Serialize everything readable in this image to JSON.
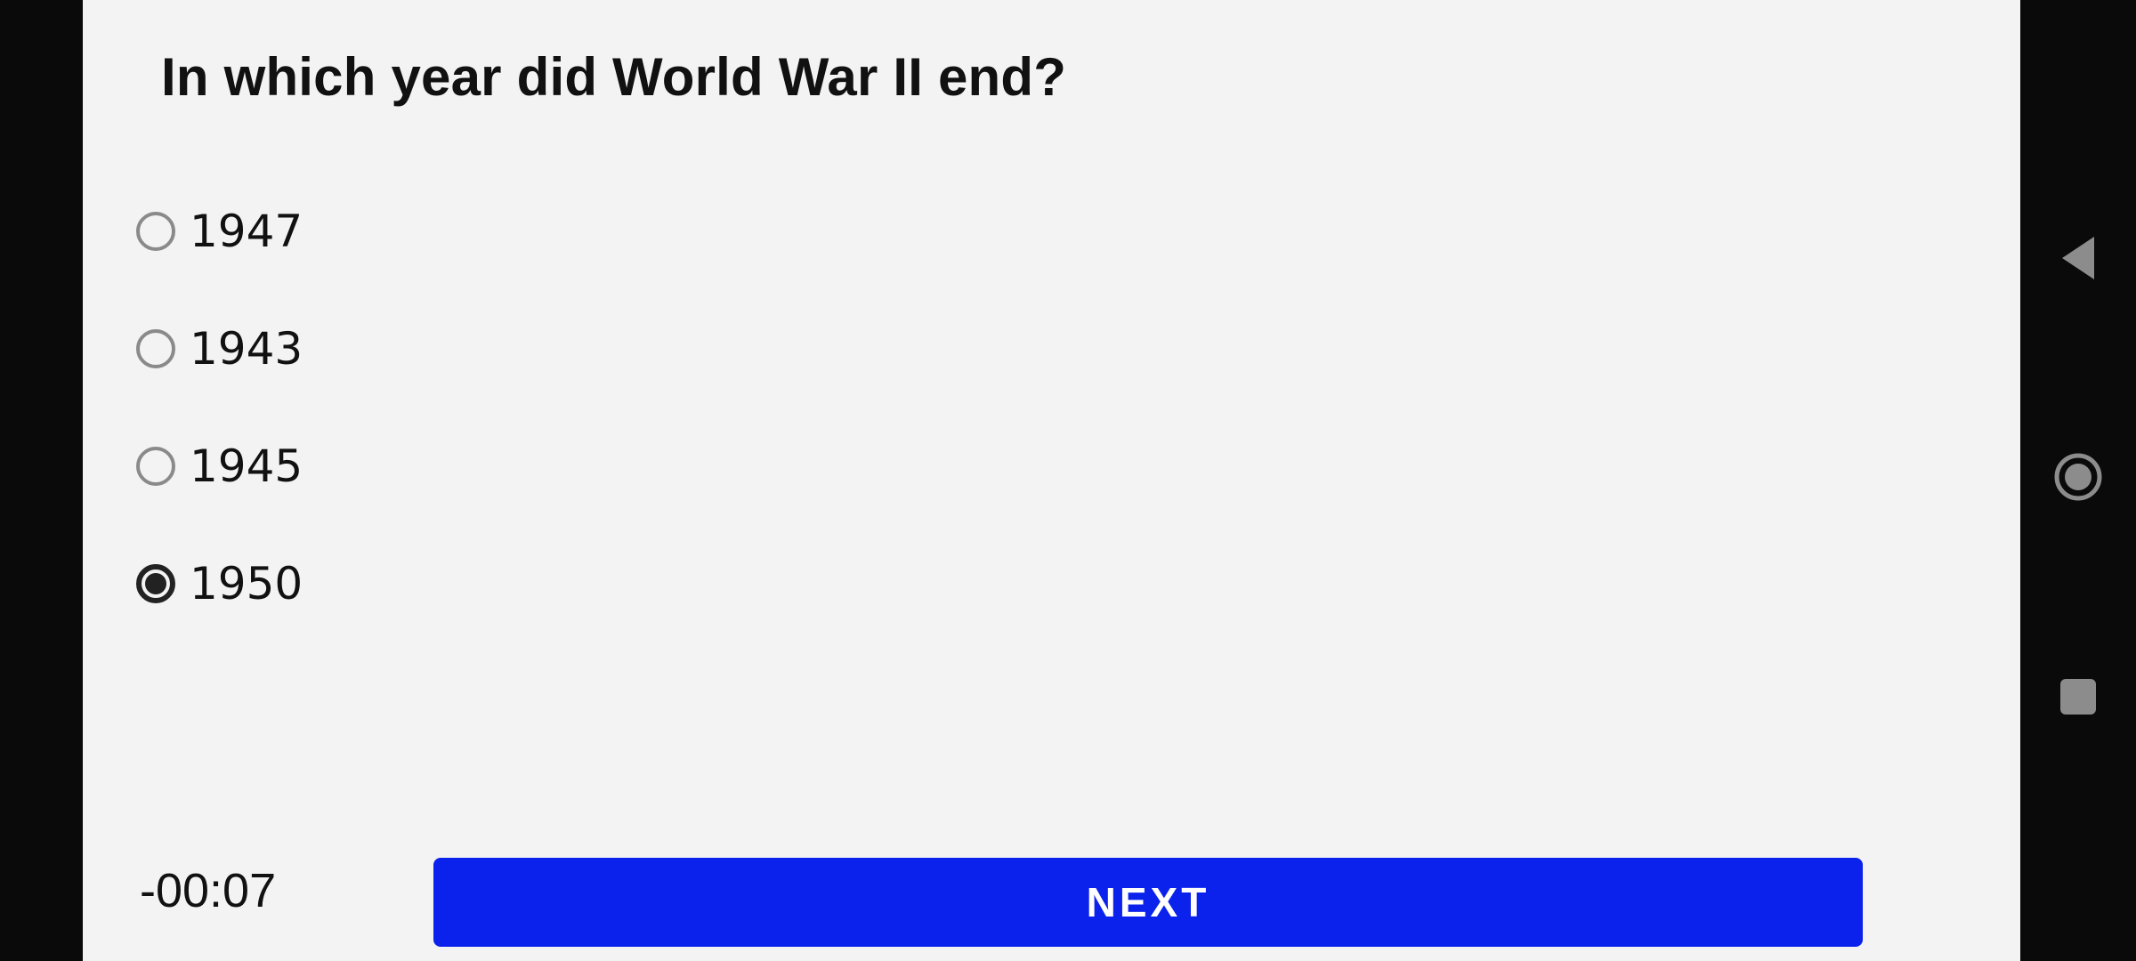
{
  "quiz": {
    "question": "In which year did World War II end?",
    "options": [
      {
        "label": "1947",
        "selected": false
      },
      {
        "label": "1943",
        "selected": false
      },
      {
        "label": "1945",
        "selected": false
      },
      {
        "label": "1950",
        "selected": true
      }
    ],
    "timer": "-00:07",
    "next_label": "NEXT"
  },
  "colors": {
    "accent": "#0a22ec",
    "background": "#f3f3f3",
    "system_bar": "#0a0a0a"
  },
  "system_nav": {
    "icons": [
      "back-icon",
      "home-icon",
      "recents-icon"
    ]
  }
}
